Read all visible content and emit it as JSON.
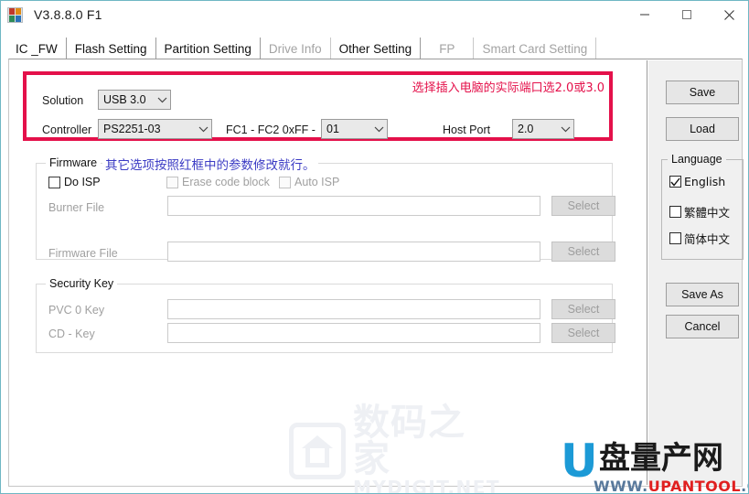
{
  "window": {
    "title": "V3.8.8.0 F1",
    "icon": "app-blocks-icon",
    "controls": {
      "minimize": "minimize-icon",
      "maximize": "maximize-icon",
      "close": "close-icon"
    }
  },
  "tabs": [
    {
      "label": "IC _FW",
      "state": "selected"
    },
    {
      "label": "Flash Setting",
      "state": "normal"
    },
    {
      "label": "Partition Setting",
      "state": "normal"
    },
    {
      "label": "Drive Info",
      "state": "disabled"
    },
    {
      "label": "Other Setting",
      "state": "normal"
    },
    {
      "label": "FP",
      "state": "disabled"
    },
    {
      "label": "Smart Card Setting",
      "state": "disabled"
    }
  ],
  "redbox": {
    "note": "选择插入电脑的实际端口选2.0或3.0",
    "note_color": "#e4104a",
    "border_color": "#e4104a",
    "solution_label": "Solution",
    "solution_value": "USB 3.0",
    "controller_label": "Controller",
    "controller_value": "PS2251-03",
    "fc_label": "FC1 - FC2   0xFF -",
    "fc_value": "01",
    "hostport_label": "Host Port",
    "hostport_value": "2.0"
  },
  "firmware": {
    "legend": "Firmware",
    "note": "其它选项按照红框中的参数修改就行。",
    "note_color": "#3b3bc4",
    "do_isp": {
      "label": "Do ISP",
      "checked": false,
      "enabled": true
    },
    "erase_code_block": {
      "label": "Erase code block",
      "checked": false,
      "enabled": false
    },
    "auto_isp": {
      "label": "Auto ISP",
      "checked": false,
      "enabled": false
    },
    "burner_file_label": "Burner File",
    "burner_file_value": "",
    "burner_select": "Select",
    "firmware_file_label": "Firmware File",
    "firmware_file_value": "",
    "firmware_select": "Select"
  },
  "security": {
    "legend": "Security Key",
    "pvc_label": "PVC 0 Key",
    "pvc_value": "",
    "pvc_select": "Select",
    "cd_label": "CD - Key",
    "cd_value": "",
    "cd_select": "Select"
  },
  "sidebar": {
    "save": "Save",
    "load": "Load",
    "language_legend": "Language",
    "languages": [
      {
        "label": "English",
        "checked": true
      },
      {
        "label": "繁體中文",
        "checked": false
      },
      {
        "label": "简体中文",
        "checked": false
      }
    ],
    "save_as": "Save As",
    "cancel": "Cancel"
  },
  "watermark": {
    "cn": "数码之家",
    "en": "MYDIGIT.NET"
  },
  "brand": {
    "u": "U",
    "cn": "盘量产网",
    "url_prefix": "WWW.",
    "url_name": "UPANTOOL",
    "url_suffix": ".COM"
  }
}
